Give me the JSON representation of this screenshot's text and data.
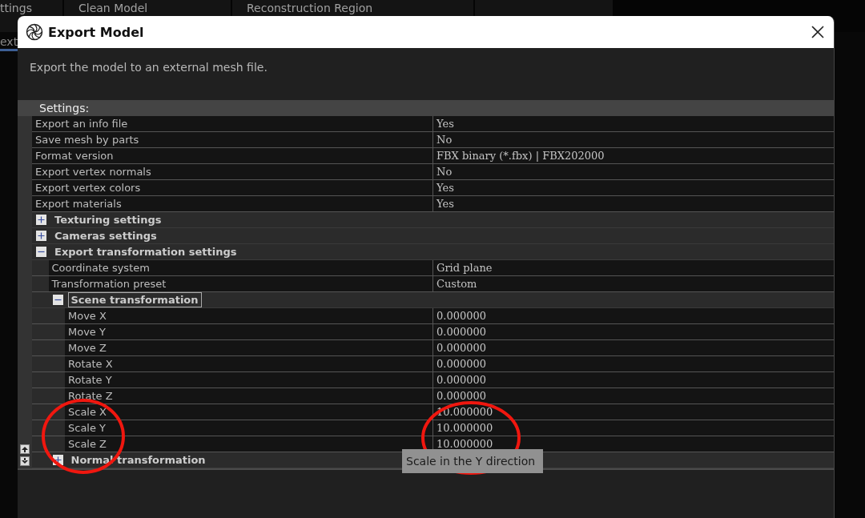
{
  "background": {
    "tabs": [
      {
        "label": "ttings"
      },
      {
        "label": "Clean Model"
      },
      {
        "label": "Reconstruction Region"
      }
    ],
    "second_row_tab": {
      "label": "ext"
    }
  },
  "dialog": {
    "title": "Export Model",
    "description": "Export the model to an external mesh file.",
    "section_header": "Settings:",
    "properties": [
      {
        "kind": "row",
        "label": "Export an info file",
        "value": "Yes",
        "selected": false
      },
      {
        "kind": "row",
        "label": "Save mesh by parts",
        "value": "No",
        "selected": false
      },
      {
        "kind": "row",
        "label": "Format version",
        "value": "FBX binary (*.fbx) | FBX202000",
        "selected": false
      },
      {
        "kind": "row",
        "label": "Export vertex normals",
        "value": "No",
        "selected": false
      },
      {
        "kind": "row",
        "label": "Export vertex colors",
        "value": "Yes",
        "selected": false
      },
      {
        "kind": "row",
        "label": "Export materials",
        "value": "Yes",
        "selected": false
      },
      {
        "kind": "group",
        "label": "Texturing settings",
        "expanded": false,
        "selected": false
      },
      {
        "kind": "group",
        "label": "Cameras settings",
        "expanded": false,
        "selected": false
      },
      {
        "kind": "group",
        "label": "Export transformation settings",
        "expanded": true,
        "selected": false,
        "children": [
          {
            "kind": "row",
            "label": "Coordinate system",
            "value": "Grid plane",
            "selected": false
          },
          {
            "kind": "row",
            "label": "Transformation preset",
            "value": "Custom",
            "selected": false
          },
          {
            "kind": "group",
            "label": "Scene transformation",
            "expanded": true,
            "selected": true,
            "children": [
              {
                "kind": "row",
                "label": "Move X",
                "value": "0.000000",
                "selected": false
              },
              {
                "kind": "row",
                "label": "Move Y",
                "value": "0.000000",
                "selected": false
              },
              {
                "kind": "row",
                "label": "Move Z",
                "value": "0.000000",
                "selected": false
              },
              {
                "kind": "row",
                "label": "Rotate X",
                "value": "0.000000",
                "selected": false
              },
              {
                "kind": "row",
                "label": "Rotate Y",
                "value": "0.000000",
                "selected": false
              },
              {
                "kind": "row",
                "label": "Rotate Z",
                "value": "0.000000",
                "selected": false
              },
              {
                "kind": "row",
                "label": "Scale X",
                "value": "10.000000",
                "selected": false
              },
              {
                "kind": "row",
                "label": "Scale Y",
                "value": "10.000000",
                "selected": false
              },
              {
                "kind": "row",
                "label": "Scale Z",
                "value": "10.000000",
                "selected": false
              }
            ]
          },
          {
            "kind": "group",
            "label": "Normal transformation",
            "expanded": false,
            "selected": false
          }
        ]
      }
    ],
    "tooltip": "Scale in the Y direction"
  }
}
